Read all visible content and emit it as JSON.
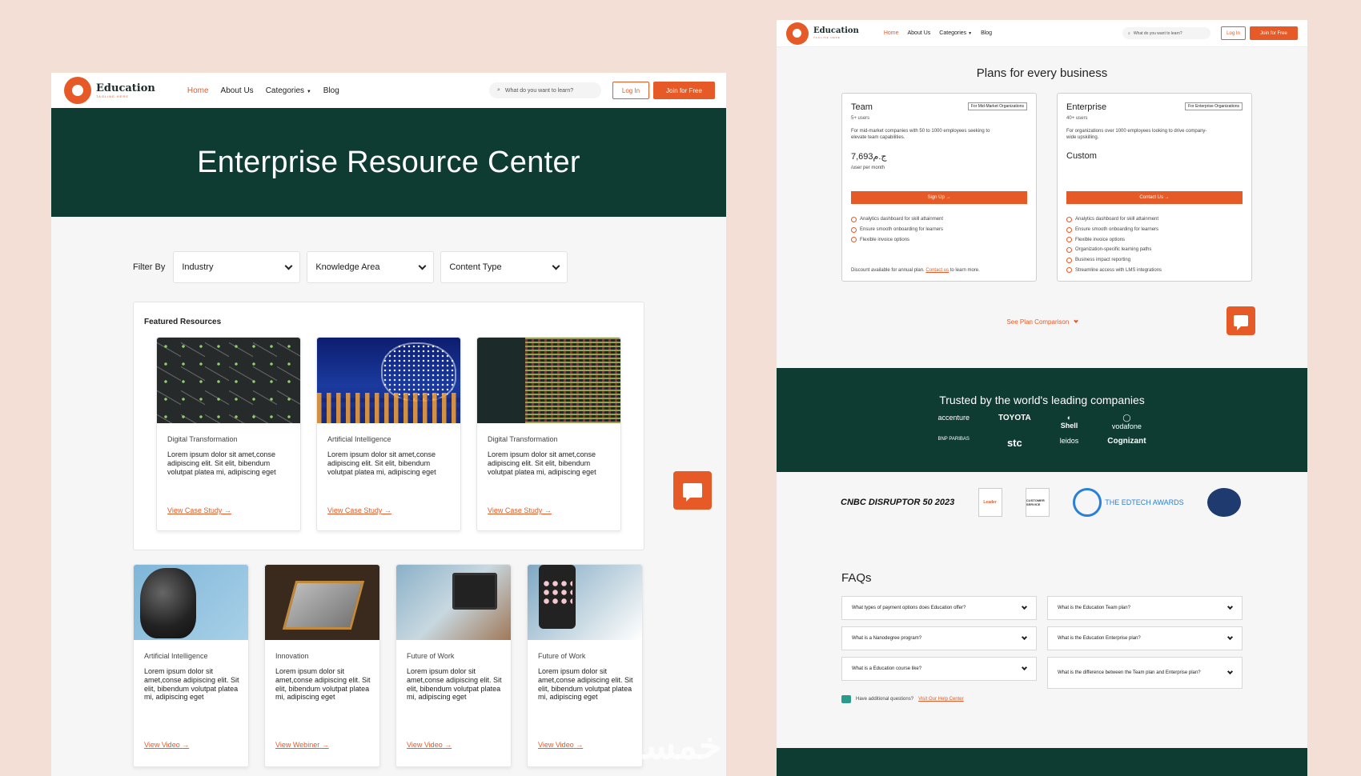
{
  "nav": {
    "brand": "Education",
    "tagline": "TAGLINE HERE",
    "links": [
      "Home",
      "About Us",
      "Categories",
      "Blog"
    ],
    "search_placeholder": "What do you want to learn?",
    "login": "Log In",
    "join": "Join for Free"
  },
  "left": {
    "hero_title": "Enterprise Resource Center",
    "filter_label": "Filter By",
    "filters": [
      "Industry",
      "Knowledge Area",
      "Content Type"
    ],
    "featured_title": "Featured Resources",
    "featured": [
      {
        "category": "Digital Transformation",
        "text": "Lorem ipsum dolor sit amet,conse adipiscing elit. Sit elit, bibendum volutpat platea mi, adipiscing eget",
        "link": "View Case Study"
      },
      {
        "category": "Artificial Intelligence",
        "text": "Lorem ipsum dolor sit amet,conse adipiscing elit. Sit elit, bibendum volutpat platea mi, adipiscing eget",
        "link": "View Case Study"
      },
      {
        "category": "Digital Transformation",
        "text": "Lorem ipsum dolor sit amet,conse adipiscing elit. Sit elit, bibendum volutpat platea mi, adipiscing eget",
        "link": "View Case Study"
      }
    ],
    "resources": [
      {
        "category": "Artificial Intelligence",
        "text": "Lorem ipsum dolor sit amet,conse adipiscing elit. Sit elit, bibendum volutpat platea mi, adipiscing eget",
        "link": "View Video"
      },
      {
        "category": "Innovation",
        "text": "Lorem ipsum dolor sit amet,conse adipiscing elit. Sit elit, bibendum volutpat platea mi, adipiscing eget",
        "link": "View Webiner"
      },
      {
        "category": "Future of Work",
        "text": "Lorem ipsum dolor sit amet,conse adipiscing elit. Sit elit, bibendum volutpat platea mi, adipiscing eget",
        "link": "View Video"
      },
      {
        "category": "Future of Work",
        "text": "Lorem ipsum dolor sit amet,conse adipiscing elit. Sit elit, bibendum volutpat platea mi, adipiscing eget",
        "link": "View Video"
      }
    ]
  },
  "right": {
    "plans_title": "Plans for every business",
    "plans": [
      {
        "name": "Team",
        "tag": "For Mid-Market Organizations",
        "users": "5+ users",
        "desc": "For mid-market companies with 50 to 1000 employees seeking to elevate team capabilities.",
        "price": "7,693ج.م",
        "per": "/user per month",
        "cta": "Sign Up",
        "features": [
          "Analytics dashboard for skill attainment",
          "Ensure smooth onboarding for learners",
          "Flexible invoice options"
        ],
        "note_before": "Discount available for annual plan.",
        "note_link": "Contact us",
        "note_after": "to learn more."
      },
      {
        "name": "Enterprise",
        "tag": "For Enterprise Organizations",
        "users": "40+ users",
        "desc": "For organizations over 1000 employees looking to drive company-wide upskilling.",
        "price": "Custom",
        "cta": "Contact Us",
        "features": [
          "Analytics dashboard for skill attainment",
          "Ensure smooth onboarding for learners",
          "Flexible invoice options",
          "Organization-specific learning paths",
          "Business impact reporting",
          "Streamline access with LMS integrations"
        ]
      }
    ],
    "see_comparison": "See Plan Comparison",
    "trusted_title": "Trusted by the world's leading companies",
    "companies": [
      "accenture",
      "TOYOTA",
      "Shell",
      "vodafone",
      "BNP PARIBAS",
      "stc",
      "leidos",
      "Cognizant"
    ],
    "awards": [
      "CNBC DISRUPTOR 50 2023",
      "Leader",
      "CUSTOMER SERVICE",
      "THE EDTECH AWARDS"
    ],
    "faqs_title": "FAQs",
    "faqs": [
      "What types of payment options does Education offer?",
      "What is the Education Team plan?",
      "What is a Nanodegree program?",
      "What is the Education Enterprise plan?",
      "What is a Education course like?",
      "What is the difference between the Team plan and Enterprise plan?"
    ],
    "help_text": "Have additional questions?",
    "help_link": "Visit Our Help Center"
  },
  "watermark": "خمسات",
  "colors": {
    "accent": "#e55a26",
    "dark_green": "#0e3b32",
    "background": "#f3dfd6"
  }
}
